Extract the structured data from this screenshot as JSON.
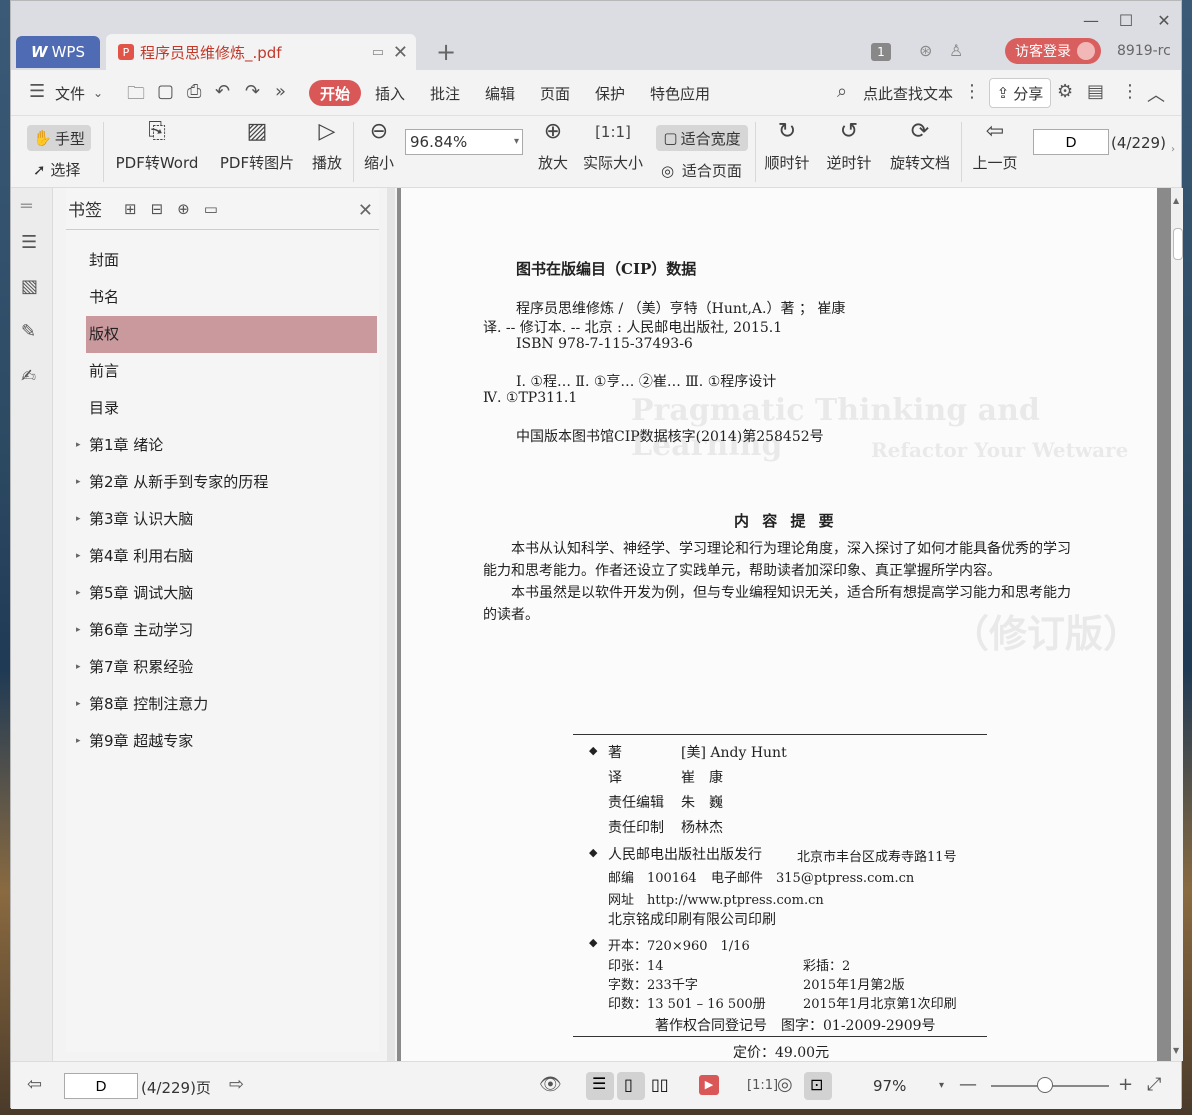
{
  "titlebar": {
    "wps_tab": "WPS",
    "doc_tab": "程序员思维修炼_.pdf",
    "badge": "1",
    "visitor_login": "访客登录",
    "user_id": "8919-rc"
  },
  "menubar": {
    "file": "文件",
    "items": [
      "开始",
      "插入",
      "批注",
      "编辑",
      "页面",
      "保护",
      "特色应用"
    ],
    "search_placeholder": "点此查找文本",
    "share": "分享"
  },
  "toolbar": {
    "hand": "手型",
    "select": "选择",
    "pdf_to_word": "PDF转Word",
    "pdf_to_image": "PDF转图片",
    "play": "播放",
    "zoom_out": "缩小",
    "zoom_value": "96.84%",
    "zoom_in": "放大",
    "actual_size": "实际大小",
    "fit_width": "适合宽度",
    "fit_page": "适合页面",
    "clockwise": "顺时针",
    "counterclockwise": "逆时针",
    "rotate_doc": "旋转文档",
    "prev_page": "上一页",
    "page_input": "D",
    "page_count": "(4/229)"
  },
  "bookmarks": {
    "title": "书签",
    "items": [
      {
        "label": "封面",
        "expandable": false
      },
      {
        "label": "书名",
        "expandable": false
      },
      {
        "label": "版权",
        "expandable": false,
        "active": true
      },
      {
        "label": "前言",
        "expandable": false
      },
      {
        "label": "目录",
        "expandable": false
      },
      {
        "label": "第1章  绪论",
        "expandable": true
      },
      {
        "label": "第2章  从新手到专家的历程",
        "expandable": true
      },
      {
        "label": "第3章  认识大脑",
        "expandable": true
      },
      {
        "label": "第4章  利用右脑",
        "expandable": true
      },
      {
        "label": "第5章  调试大脑",
        "expandable": true
      },
      {
        "label": "第6章  主动学习",
        "expandable": true
      },
      {
        "label": "第7章  积累经验",
        "expandable": true
      },
      {
        "label": "第8章  控制注意力",
        "expandable": true
      },
      {
        "label": "第9章  超越专家",
        "expandable": true
      }
    ]
  },
  "page": {
    "cip_title": "图书在版编目（CIP）数据",
    "cip_lines": [
      "程序员思维修炼 / （美）亨特（Hunt,A.）著 ； 崔康",
      "译. -- 修订本. -- 北京 : 人民邮电出版社, 2015.1",
      "ISBN 978-7-115-37493-6",
      "Ⅰ. ①程… Ⅱ. ①亨… ②崔… Ⅲ. ①程序设计",
      "Ⅳ. ①TP311.1",
      "中国版本图书馆CIP数据核字(2014)第258452号"
    ],
    "summary_title": "内 容 提 要",
    "summary_p1": "本书从认知科学、神经学、学习理论和行为理论角度，深入探讨了如何才能具备优秀的学习能力和思考能力。作者还设立了实践单元，帮助读者加深印象、真正掌握所学内容。",
    "summary_p2": "本书虽然是以软件开发为例，但与专业编程知识无关，适合所有想提高学习能力和思考能力的读者。",
    "credits": {
      "author_label": "著",
      "author": "[美] Andy Hunt",
      "translator_label": "译",
      "translator": "崔　康",
      "editor_label": "责任编辑",
      "editor": "朱　巍",
      "printer_label": "责任印制",
      "printer": "杨林杰",
      "publisher": "人民邮电出版社出版发行",
      "address": "北京市丰台区成寿寺路11号",
      "postcode": "邮编　100164",
      "email": "电子邮件　315@ptpress.com.cn",
      "website": "网址　http://www.ptpress.com.cn",
      "printing": "北京铭成印刷有限公司印刷",
      "format": "开本：720×960　1/16",
      "sheets": "印张：14",
      "color_pages": "彩插：2",
      "words": "字数：233千字",
      "edition": "2015年1月第2版",
      "print_count": "印数：13 501 – 16 500册",
      "print_date": "2015年1月北京第1次印刷",
      "copyright_reg": "著作权合同登记号　图字：01-2009-2909号",
      "price": "定价：49.00元"
    },
    "ghost_title_en": "Pragmatic Thinking and Learning",
    "ghost_subtitle_en": "Refactor Your Wetware",
    "ghost_edition": "（修订版）"
  },
  "statusbar": {
    "page_input": "D",
    "page_count": "(4/229)页",
    "zoom": "97%"
  }
}
